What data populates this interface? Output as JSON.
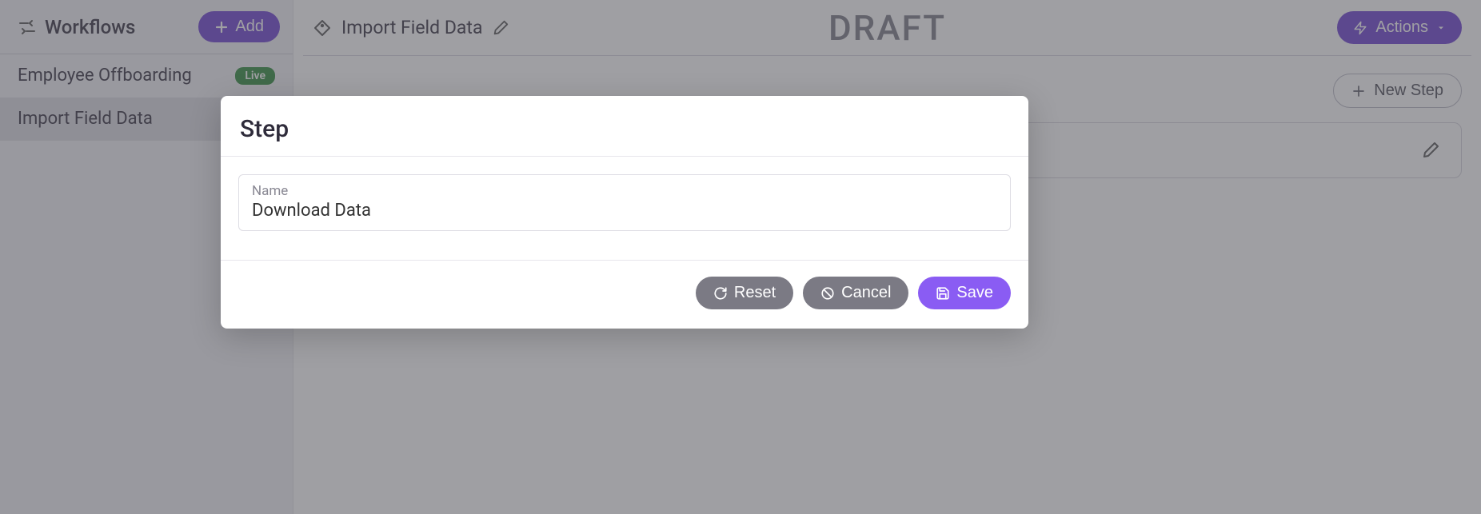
{
  "sidebar": {
    "title": "Workflows",
    "add_label": "Add",
    "items": [
      {
        "label": "Employee Offboarding",
        "status": "Live"
      },
      {
        "label": "Import Field Data",
        "status": ""
      }
    ]
  },
  "header": {
    "workflow_title": "Import Field Data",
    "watermark": "DRAFT",
    "actions_label": "Actions"
  },
  "main": {
    "new_step_label": "New Step"
  },
  "modal": {
    "title": "Step",
    "name_label": "Name",
    "name_value": "Download Data",
    "reset_label": "Reset",
    "cancel_label": "Cancel",
    "save_label": "Save"
  }
}
